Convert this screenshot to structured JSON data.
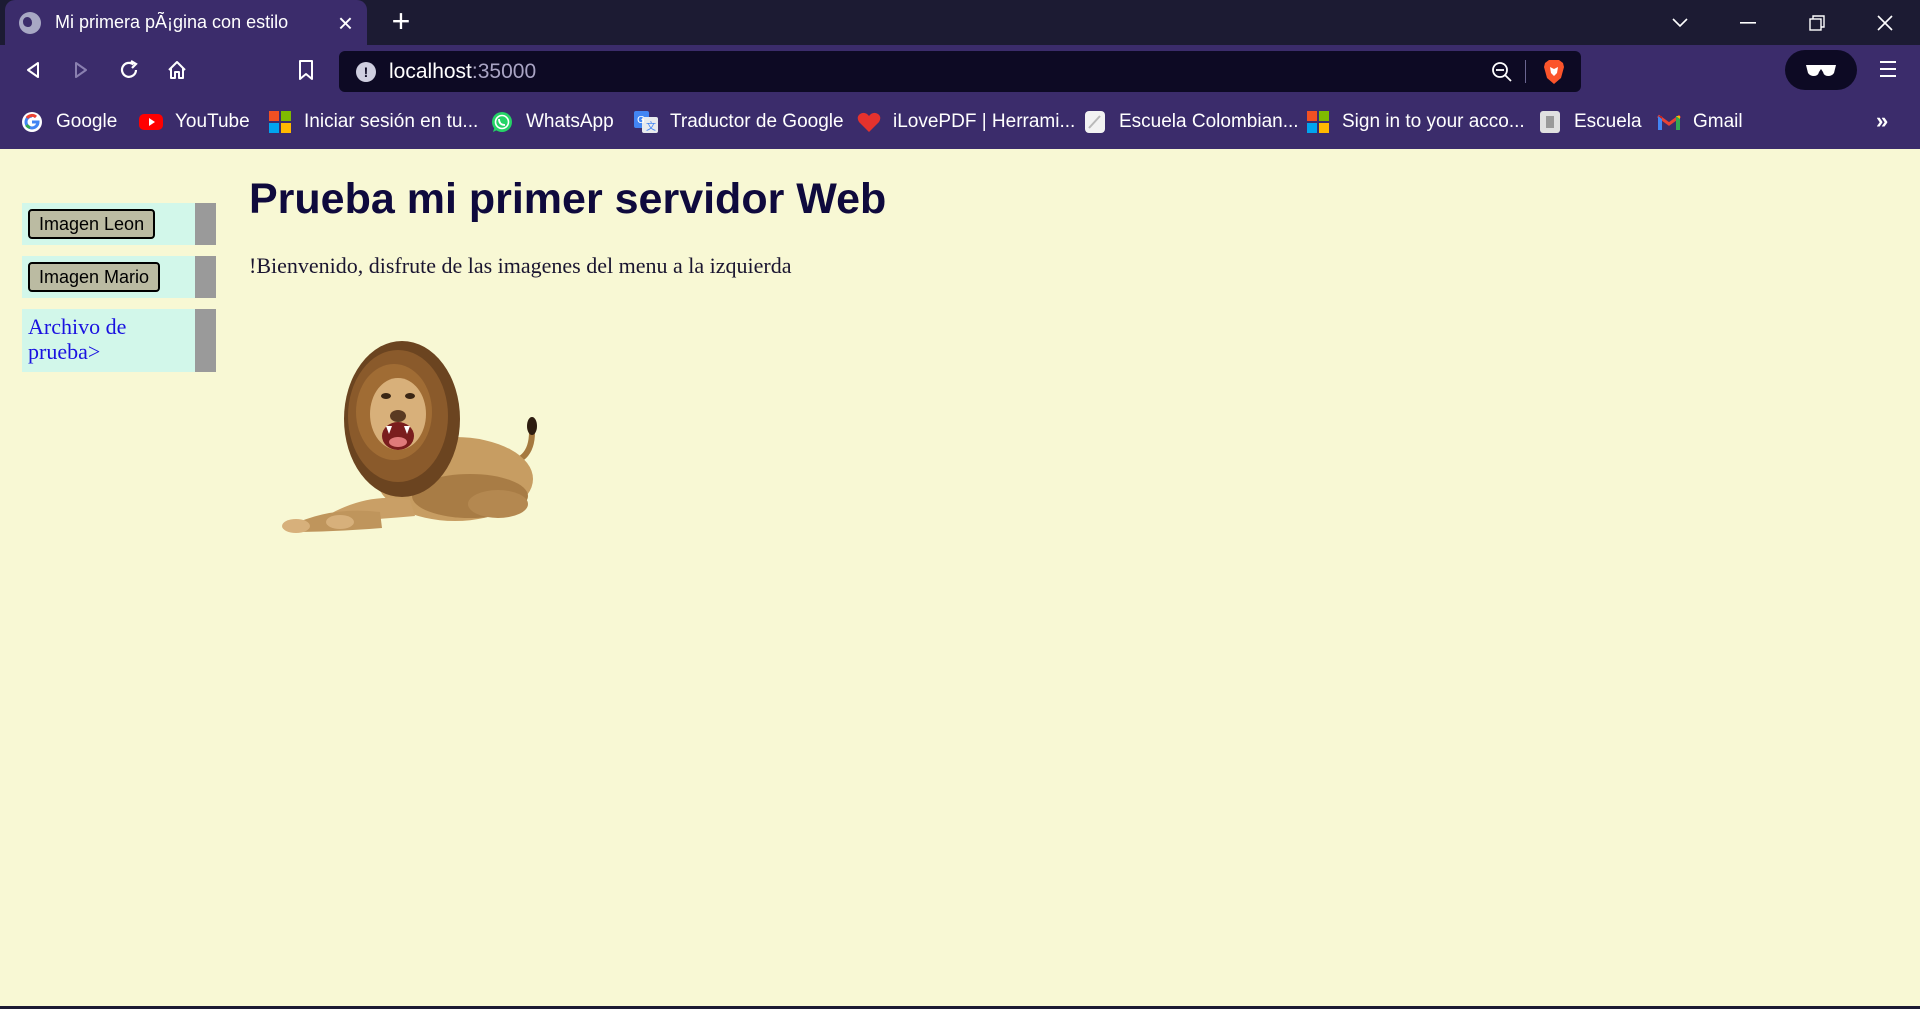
{
  "browser": {
    "tab_title": "Mi primera pÃ¡gina con estilo",
    "url_host": "localhost",
    "url_port": ":35000",
    "bookmarks": [
      {
        "label": "Google",
        "icon": "google-icon"
      },
      {
        "label": "YouTube",
        "icon": "youtube-icon"
      },
      {
        "label": "Iniciar sesión en tu...",
        "icon": "microsoft-icon"
      },
      {
        "label": "WhatsApp",
        "icon": "whatsapp-icon"
      },
      {
        "label": "Traductor de Google",
        "icon": "google-translate-icon"
      },
      {
        "label": "iLovePDF | Herrami...",
        "icon": "ilovepdf-icon"
      },
      {
        "label": "Escuela Colombian...",
        "icon": "page-icon"
      },
      {
        "label": "Sign in to your acco...",
        "icon": "microsoft-icon"
      },
      {
        "label": "Escuela",
        "icon": "page-icon"
      },
      {
        "label": "Gmail",
        "icon": "gmail-icon"
      }
    ],
    "more_bookmarks": "»"
  },
  "page": {
    "menu": {
      "btn_leon": "Imagen Leon",
      "btn_mario": "Imagen Mario",
      "link_archivo": "Archivo de prueba>"
    },
    "heading": "Prueba mi primer servidor Web",
    "welcome": "!Bienvenido, disfrute de las imagenes del menu a la izquierda",
    "image": "lion-image"
  },
  "colors": {
    "page_bg": "#f8f8d4",
    "chrome_bg": "#3b2c6b",
    "menu_bg": "#d2f7ea",
    "link": "#1a12e0"
  }
}
